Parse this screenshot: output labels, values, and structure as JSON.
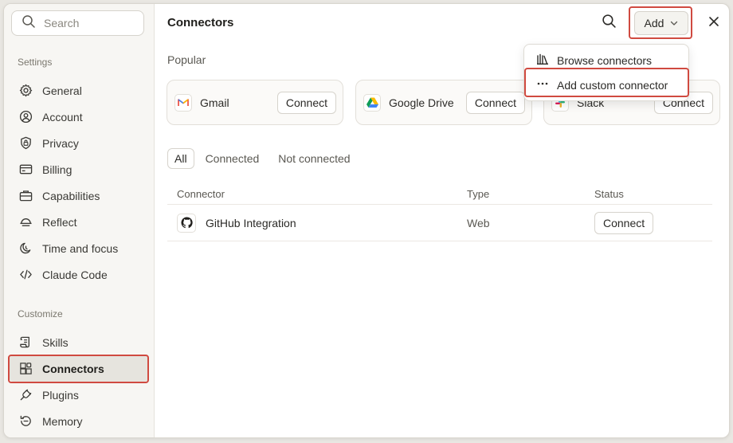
{
  "search": {
    "placeholder": "Search"
  },
  "sidebar": {
    "settings_label": "Settings",
    "settings_items": [
      {
        "label": "General",
        "icon": "gear-icon"
      },
      {
        "label": "Account",
        "icon": "user-circle-icon"
      },
      {
        "label": "Privacy",
        "icon": "shield-lock-icon"
      },
      {
        "label": "Billing",
        "icon": "credit-card-icon"
      },
      {
        "label": "Capabilities",
        "icon": "briefcase-icon"
      },
      {
        "label": "Reflect",
        "icon": "horizon-icon"
      },
      {
        "label": "Time and focus",
        "icon": "moon-clock-icon"
      },
      {
        "label": "Claude Code",
        "icon": "code-icon"
      }
    ],
    "customize_label": "Customize",
    "customize_items": [
      {
        "label": "Skills",
        "icon": "scroll-icon"
      },
      {
        "label": "Connectors",
        "icon": "grid-plus-icon",
        "active": true
      },
      {
        "label": "Plugins",
        "icon": "plug-icon"
      },
      {
        "label": "Memory",
        "icon": "history-icon"
      }
    ]
  },
  "main": {
    "title": "Connectors",
    "add_label": "Add",
    "popular_label": "Popular",
    "popular": [
      {
        "name": "Gmail",
        "connect": "Connect"
      },
      {
        "name": "Google Drive",
        "connect": "Connect"
      },
      {
        "name": "Slack",
        "connect": "Connect"
      }
    ],
    "filters": [
      "All",
      "Connected",
      "Not connected"
    ],
    "table": {
      "headers": [
        "Connector",
        "Type",
        "Status"
      ],
      "rows": [
        {
          "name": "GitHub Integration",
          "type": "Web",
          "status": "Connect"
        }
      ]
    }
  },
  "dropdown": {
    "items": [
      {
        "label": "Browse connectors",
        "icon": "library-icon"
      },
      {
        "label": "Add custom connector",
        "icon": "ellipsis-icon"
      }
    ]
  },
  "colors": {
    "highlight": "#d04a40",
    "sidebar_bg": "#f7f6f3",
    "active_bg": "#e6e4de"
  }
}
